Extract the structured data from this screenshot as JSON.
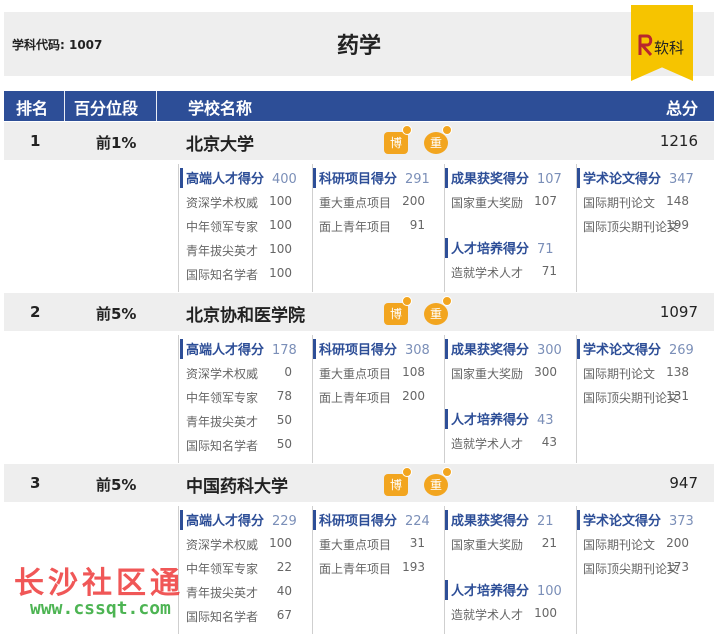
{
  "header": {
    "code_label": "学科代码: 1007",
    "title": "药学",
    "logo_text": "软科",
    "columns": {
      "rank": "排名",
      "percentile": "百分位段",
      "school": "学校名称",
      "total": "总分"
    }
  },
  "badges": {
    "bo": "博",
    "zhong": "重"
  },
  "schools": [
    {
      "rank": "1",
      "percentile": "前1%",
      "name": "北京大学",
      "total": "1216",
      "talent": {
        "label": "高端人才得分",
        "value": "400",
        "items": [
          {
            "label": "资深学术权威",
            "value": "100"
          },
          {
            "label": "中年领军专家",
            "value": "100"
          },
          {
            "label": "青年拔尖英才",
            "value": "100"
          },
          {
            "label": "国际知名学者",
            "value": "100"
          }
        ]
      },
      "research": {
        "label": "科研项目得分",
        "value": "291",
        "items": [
          {
            "label": "重大重点项目",
            "value": "200"
          },
          {
            "label": "面上青年项目",
            "value": "91"
          }
        ]
      },
      "award": {
        "label": "成果获奖得分",
        "value": "107",
        "items": [
          {
            "label": "国家重大奖励",
            "value": "107"
          }
        ]
      },
      "training": {
        "label": "人才培养得分",
        "value": "71",
        "items": [
          {
            "label": "造就学术人才",
            "value": "71"
          }
        ]
      },
      "paper": {
        "label": "学术论文得分",
        "value": "347",
        "items": [
          {
            "label": "国际期刊论文",
            "value": "148"
          },
          {
            "label": "国际顶尖期刊论文",
            "value": "199"
          }
        ]
      }
    },
    {
      "rank": "2",
      "percentile": "前5%",
      "name": "北京协和医学院",
      "total": "1097",
      "talent": {
        "label": "高端人才得分",
        "value": "178",
        "items": [
          {
            "label": "资深学术权威",
            "value": "0"
          },
          {
            "label": "中年领军专家",
            "value": "78"
          },
          {
            "label": "青年拔尖英才",
            "value": "50"
          },
          {
            "label": "国际知名学者",
            "value": "50"
          }
        ]
      },
      "research": {
        "label": "科研项目得分",
        "value": "308",
        "items": [
          {
            "label": "重大重点项目",
            "value": "108"
          },
          {
            "label": "面上青年项目",
            "value": "200"
          }
        ]
      },
      "award": {
        "label": "成果获奖得分",
        "value": "300",
        "items": [
          {
            "label": "国家重大奖励",
            "value": "300"
          }
        ]
      },
      "training": {
        "label": "人才培养得分",
        "value": "43",
        "items": [
          {
            "label": "造就学术人才",
            "value": "43"
          }
        ]
      },
      "paper": {
        "label": "学术论文得分",
        "value": "269",
        "items": [
          {
            "label": "国际期刊论文",
            "value": "138"
          },
          {
            "label": "国际顶尖期刊论文",
            "value": "131"
          }
        ]
      }
    },
    {
      "rank": "3",
      "percentile": "前5%",
      "name": "中国药科大学",
      "total": "947",
      "talent": {
        "label": "高端人才得分",
        "value": "229",
        "items": [
          {
            "label": "资深学术权威",
            "value": "100"
          },
          {
            "label": "中年领军专家",
            "value": "22"
          },
          {
            "label": "青年拔尖英才",
            "value": "40"
          },
          {
            "label": "国际知名学者",
            "value": "67"
          }
        ]
      },
      "research": {
        "label": "科研项目得分",
        "value": "224",
        "items": [
          {
            "label": "重大重点项目",
            "value": "31"
          },
          {
            "label": "面上青年项目",
            "value": "193"
          }
        ]
      },
      "award": {
        "label": "成果获奖得分",
        "value": "21",
        "items": [
          {
            "label": "国家重大奖励",
            "value": "21"
          }
        ]
      },
      "training": {
        "label": "人才培养得分",
        "value": "100",
        "items": [
          {
            "label": "造就学术人才",
            "value": "100"
          }
        ]
      },
      "paper": {
        "label": "学术论文得分",
        "value": "373",
        "items": [
          {
            "label": "国际期刊论文",
            "value": "200"
          },
          {
            "label": "国际顶尖期刊论文",
            "value": "173"
          }
        ]
      }
    }
  ],
  "watermark": {
    "line1": "长沙社区通",
    "line2": "www.cssqt.com"
  },
  "colors": {
    "header_bg": "#2d4e97",
    "row_bg": "#eeeeee",
    "badge": "#f2a51f",
    "logo": "#f6c400"
  }
}
